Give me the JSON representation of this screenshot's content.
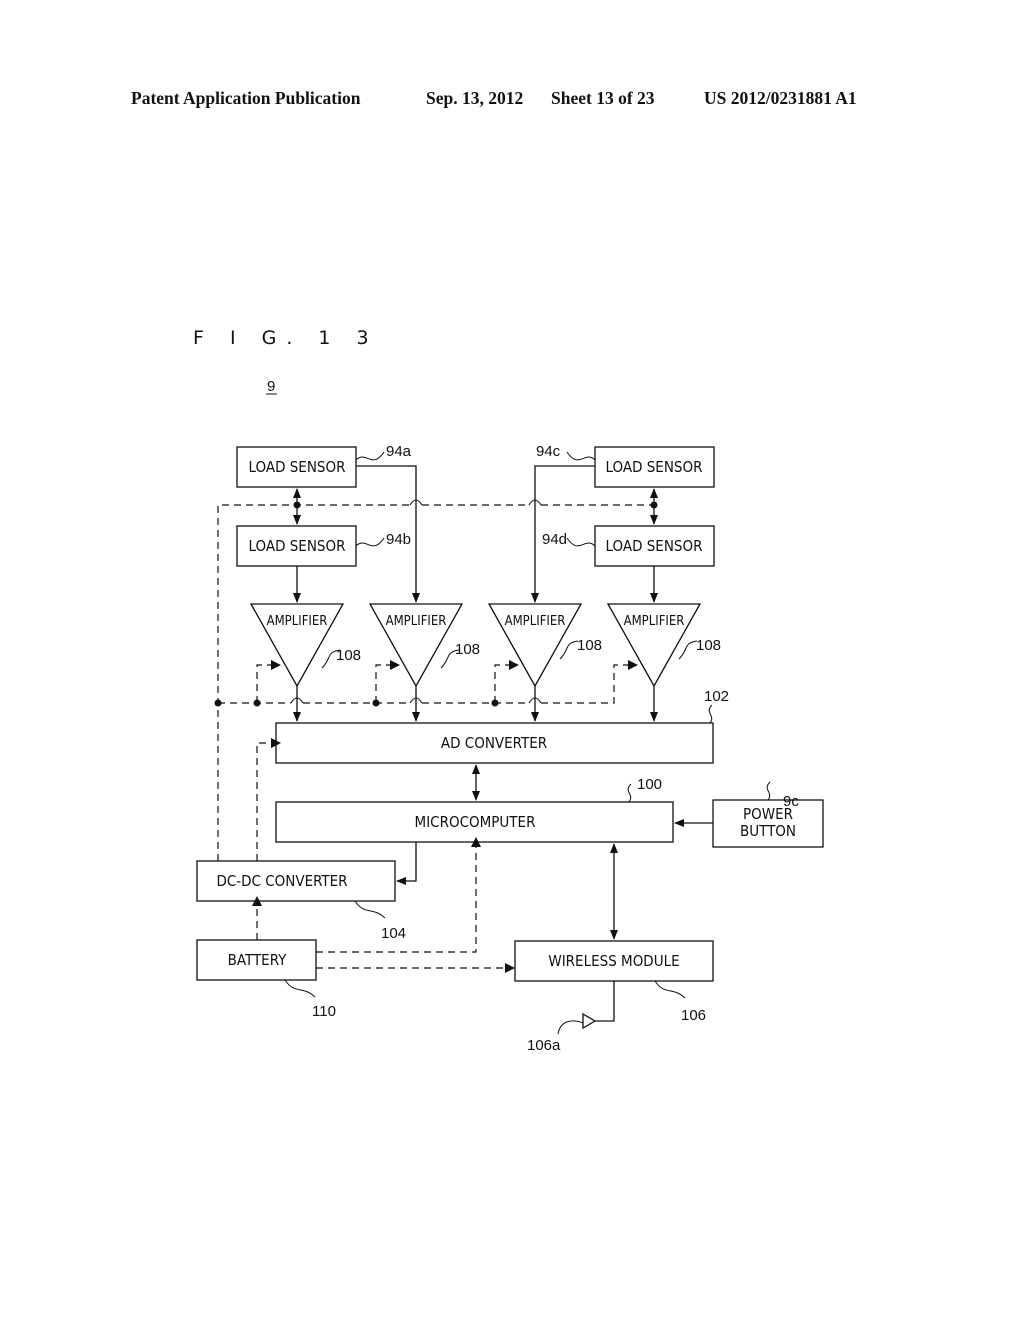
{
  "header": {
    "publication": "Patent Application Publication",
    "date": "Sep. 13, 2012",
    "sheet": "Sheet 13 of 23",
    "number": "US 2012/0231881 A1"
  },
  "figure": {
    "title": "F I G. 1 3",
    "device_ref": "9"
  },
  "blocks": {
    "load_sensor_a": {
      "label": "LOAD SENSOR",
      "ref": "94a"
    },
    "load_sensor_b": {
      "label": "LOAD SENSOR",
      "ref": "94b"
    },
    "load_sensor_c": {
      "label": "LOAD SENSOR",
      "ref": "94c"
    },
    "load_sensor_d": {
      "label": "LOAD SENSOR",
      "ref": "94d"
    },
    "amplifiers": [
      {
        "label": "AMPLIFIER",
        "ref": "108"
      },
      {
        "label": "AMPLIFIER",
        "ref": "108"
      },
      {
        "label": "AMPLIFIER",
        "ref": "108"
      },
      {
        "label": "AMPLIFIER",
        "ref": "108"
      }
    ],
    "ad_converter": {
      "label": "AD CONVERTER",
      "ref": "102"
    },
    "microcomputer": {
      "label": "MICROCOMPUTER",
      "ref": "100"
    },
    "power_button": {
      "label_line1": "POWER",
      "label_line2": "BUTTON",
      "ref": "9c"
    },
    "dcdc_converter": {
      "label": "DC-DC CONVERTER",
      "ref": "104"
    },
    "battery": {
      "label": "BATTERY",
      "ref": "110"
    },
    "wireless_module": {
      "label": "WIRELESS MODULE",
      "ref": "106"
    },
    "antenna": {
      "ref": "106a"
    }
  }
}
